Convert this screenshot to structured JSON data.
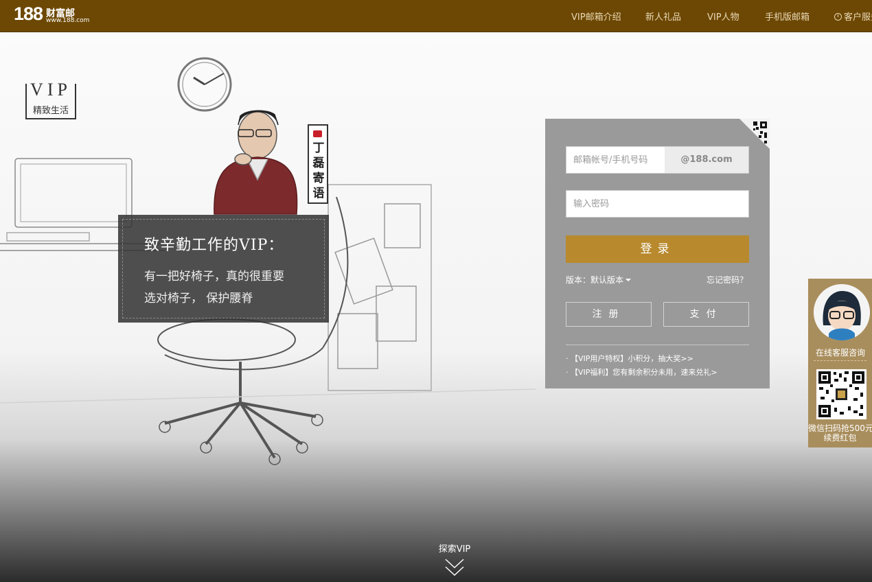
{
  "header": {
    "logo_number": "188",
    "logo_text": "财富邮",
    "logo_url": "www.188.com",
    "nav": [
      "VIP邮箱介绍",
      "新人礼品",
      "VIP人物",
      "手机版邮箱"
    ],
    "service": "客户服务"
  },
  "hero": {
    "vip_badge_title": "VIP",
    "vip_badge_sub": "精致生活",
    "tag_text": "丁磊寄语",
    "quote_title": "致辛勤工作的VIP：",
    "quote_line1": "有一把好椅子，真的很重要",
    "quote_line2": "选对椅子，  保护腰脊"
  },
  "login": {
    "account_placeholder": "邮箱帐号/手机号码",
    "domain": "@188.com",
    "password_placeholder": "输入密码",
    "submit": "登录",
    "version_label": "版本：默认版本",
    "forgot": "忘记密码？",
    "register": "注册",
    "pay": "支付",
    "promos": [
      "【VIP用户特权】小积分，抽大奖>>",
      "【VIP福利】您有剩余积分未用，速来兑礼>"
    ]
  },
  "support": {
    "online": "在线客服咨询",
    "wechat_line1": "微信扫码抢500元",
    "wechat_line2": "续费红包"
  },
  "explore": "探索VIP",
  "colors": {
    "header_bg": "#6d4804",
    "login_button": "#b8892d",
    "panel_bg": "#9a9a9a",
    "support_bg": "#a98e5d"
  }
}
